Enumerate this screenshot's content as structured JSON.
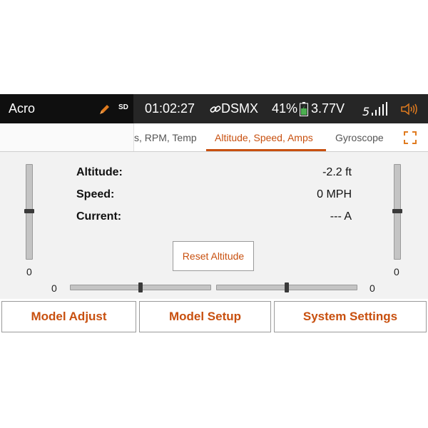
{
  "status_bar": {
    "model_name": "Acro",
    "edit_icon": "pencil-icon",
    "sd_label": "SD",
    "timer": "01:02:27",
    "link_icon": "link-icon",
    "protocol": "DSMX",
    "battery_percent": "41%",
    "battery_icon": "battery-icon",
    "voltage": "3.77V",
    "signal_icon": "signal-icon",
    "speaker_icon": "speaker-icon",
    "accent_color": "#e07b1f"
  },
  "tabs": {
    "previous": "s, RPM, Temp",
    "active": "Altitude, Speed, Amps",
    "next": "Gyroscope",
    "expand_icon": "fullscreen-icon",
    "active_color": "#c8500f"
  },
  "telemetry": {
    "altitude": {
      "label": "Altitude:",
      "value": "-2.2 ft"
    },
    "speed": {
      "label": "Speed:",
      "value": "0 MPH"
    },
    "current": {
      "label": "Current:",
      "value": "--- A"
    }
  },
  "trims": {
    "left_vertical": "0",
    "right_vertical": "0",
    "left_horizontal": "0",
    "right_horizontal": "0"
  },
  "reset_button": "Reset Altitude",
  "bottom_buttons": {
    "model_adjust": "Model Adjust",
    "model_setup": "Model Setup",
    "system_settings": "System Settings"
  }
}
